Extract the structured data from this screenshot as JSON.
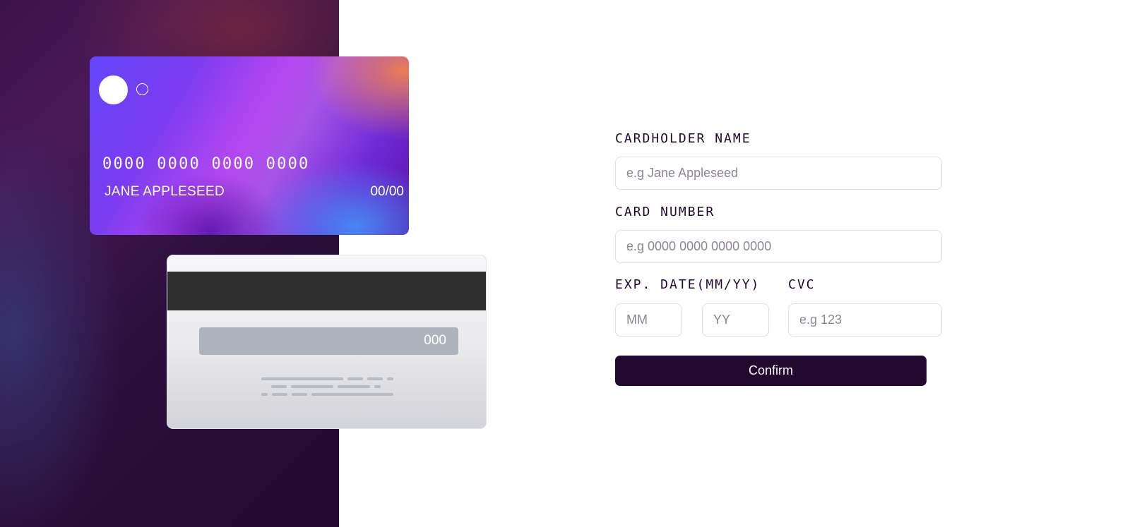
{
  "card_front": {
    "number": "0000 0000 0000 0000",
    "name": "JANE APPLESEED",
    "expiry": "00/00"
  },
  "card_back": {
    "cvc": "000"
  },
  "form": {
    "cardholder_label": "CARDHOLDER NAME",
    "cardholder_placeholder": "e.g Jane Appleseed",
    "card_number_label": "CARD NUMBER",
    "card_number_placeholder": "e.g 0000 0000 0000 0000",
    "exp_date_label": "EXP. DATE(MM/YY)",
    "month_placeholder": "MM",
    "year_placeholder": "YY",
    "cvc_label": "CVC",
    "cvc_placeholder": "e.g 123",
    "confirm_label": "Confirm"
  },
  "colors": {
    "primary_dark": "#21092f",
    "input_border": "#dedddf",
    "placeholder": "#8e8593",
    "white": "#ffffff"
  }
}
